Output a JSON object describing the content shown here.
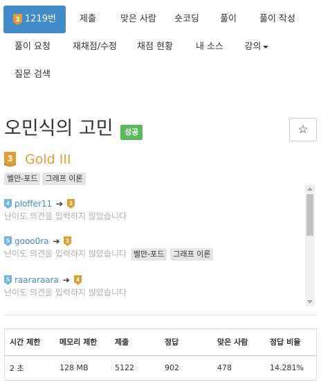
{
  "nav": {
    "problem_tab": {
      "tier_icon": "gold-tier-icon",
      "tier_num": "3",
      "label": "1219번"
    },
    "items": [
      "제출",
      "맞은 사람",
      "숏코딩",
      "풀이",
      "풀이 작성",
      "풀이 요청",
      "재채점/수정",
      "채점 현황",
      "내 소스",
      "강의",
      "질문 검색"
    ]
  },
  "problem": {
    "title": "오민식의 고민",
    "status": "성공",
    "star_icon": "☆",
    "tier_num": "3",
    "tier_name": "Gold III",
    "tags": [
      "벨만-포드",
      "그래프 이론"
    ]
  },
  "opinions": [
    {
      "user_tier": "4",
      "user": "ploffer11",
      "arrow": "➔",
      "voted_tier": "3",
      "comment": "난이도 의견을 입력하지 않았습니다",
      "tags": []
    },
    {
      "user_tier": "5",
      "user": "gooo0ra",
      "arrow": "➔",
      "voted_tier": "3",
      "comment": "난이도 의견을 입력하지 않았습니다",
      "tags": [
        "벨만-포드",
        "그래프 이론"
      ]
    },
    {
      "user_tier": "5",
      "user": "raararaara",
      "arrow": "➔",
      "voted_tier": "4",
      "comment": "난이도 의견을 입력하지 않았습니다",
      "tags": []
    }
  ],
  "table": {
    "headers": [
      "시간 제한",
      "메모리 제한",
      "제출",
      "정답",
      "맞은 사람",
      "정답 비율"
    ],
    "row": [
      "2 초",
      "128 MB",
      "5122",
      "902",
      "478",
      "14.281%"
    ]
  },
  "colors": {
    "gold": "#e09e37",
    "silver": "#435f7a",
    "accent": "#428bca",
    "success": "#5cb85c"
  }
}
